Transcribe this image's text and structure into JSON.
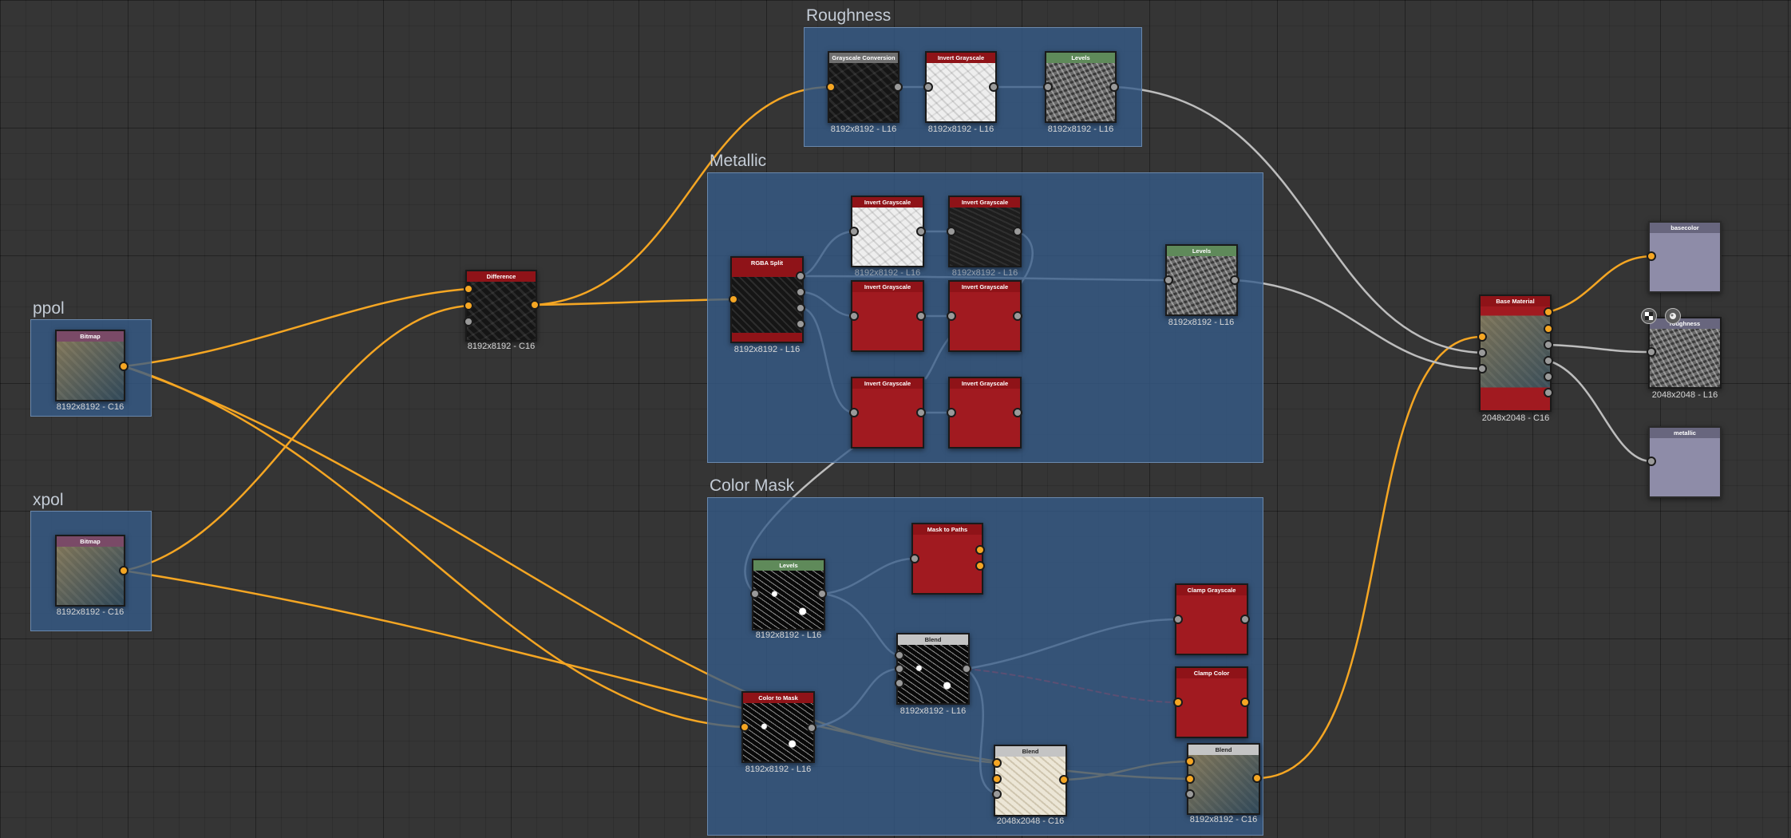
{
  "frames": {
    "roughness": "Roughness",
    "metallic": "Metallic",
    "color_mask": "Color Mask",
    "ppol": "ppol",
    "xpol": "xpol"
  },
  "nodes": {
    "bitmap_ppol": {
      "title": "Bitmap",
      "caption": "8192x8192 - C16"
    },
    "bitmap_xpol": {
      "title": "Bitmap",
      "caption": "8192x8192 - C16"
    },
    "difference": {
      "title": "Difference",
      "caption": "8192x8192 - C16"
    },
    "grayscale_conversion": {
      "title": "Grayscale Conversion",
      "caption": "8192x8192 - L16"
    },
    "invert_grayscale_r1": {
      "title": "Invert Grayscale",
      "caption": "8192x8192 - L16"
    },
    "levels_r": {
      "title": "Levels",
      "caption": "8192x8192 - L16"
    },
    "rgba_split": {
      "title": "RGBA Split",
      "caption": "8192x8192 - L16"
    },
    "invert_m1": {
      "title": "Invert Grayscale",
      "caption": "8192x8192 - L16"
    },
    "invert_m2": {
      "title": "Invert Grayscale",
      "caption": "8192x8192 - L16"
    },
    "invert_m3": {
      "title": "Invert Grayscale"
    },
    "invert_m4": {
      "title": "Invert Grayscale"
    },
    "invert_m5": {
      "title": "Invert Grayscale"
    },
    "invert_m6": {
      "title": "Invert Grayscale"
    },
    "levels_m": {
      "title": "Levels",
      "caption": "8192x8192 - L16"
    },
    "levels_c": {
      "title": "Levels",
      "caption": "8192x8192 - L16"
    },
    "mask_to_paths": {
      "title": "Mask to Paths"
    },
    "blend1": {
      "title": "Blend",
      "caption": "8192x8192 - L16"
    },
    "color_to_mask": {
      "title": "Color to Mask",
      "caption": "8192x8192 - L16"
    },
    "clamp_grayscale": {
      "title": "Clamp Grayscale"
    },
    "clamp_color": {
      "title": "Clamp Color"
    },
    "blend2": {
      "title": "Blend",
      "caption": "2048x2048 - C16"
    },
    "blend3": {
      "title": "Blend",
      "caption": "8192x8192 - C16"
    },
    "base_material": {
      "title": "Base Material",
      "caption": "2048x2048 - C16"
    },
    "out_basecolor": {
      "title": "basecolor"
    },
    "out_roughness": {
      "title": "roughness",
      "caption": "2048x2048 - L16"
    },
    "out_metallic": {
      "title": "metallic"
    }
  },
  "icons": {
    "overlay_left": "checker-icon",
    "overlay_right": "material-sphere-icon"
  },
  "colors": {
    "color_wire": "#f5a623",
    "gray_wire": "#bdbdbd",
    "frame_fill": "#365c8a",
    "node_red": "#a11a20",
    "background": "#353535"
  }
}
